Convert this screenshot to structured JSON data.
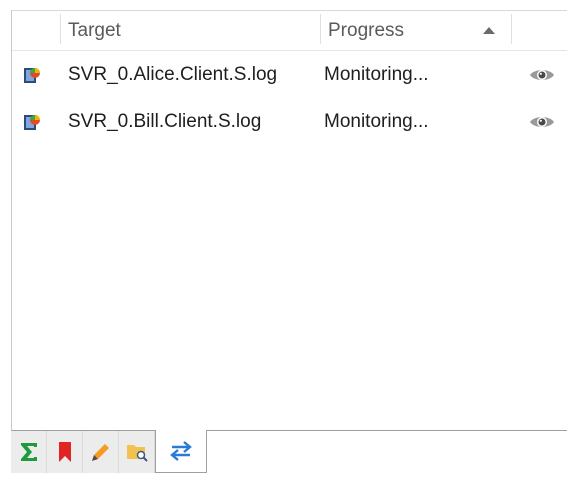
{
  "columns": {
    "target": "Target",
    "progress": "Progress"
  },
  "rows": [
    {
      "target": "SVR_0.Alice.Client.S.log",
      "progress": "Monitoring...",
      "icon": "log-app-icon",
      "status_icon": "eye-icon"
    },
    {
      "target": "SVR_0.Bill.Client.S.log",
      "progress": "Monitoring...",
      "icon": "log-app-icon",
      "status_icon": "eye-icon"
    }
  ],
  "tabs": [
    {
      "icon": "sigma-icon",
      "color": "#1f9a3f"
    },
    {
      "icon": "bookmark-icon",
      "color": "#e02424"
    },
    {
      "icon": "pencil-icon",
      "color": "#f59a23"
    },
    {
      "icon": "folder-search-icon",
      "color": "#f2c14e"
    },
    {
      "icon": "swap-arrows-icon",
      "color": "#2a7bd6",
      "active": true
    }
  ]
}
